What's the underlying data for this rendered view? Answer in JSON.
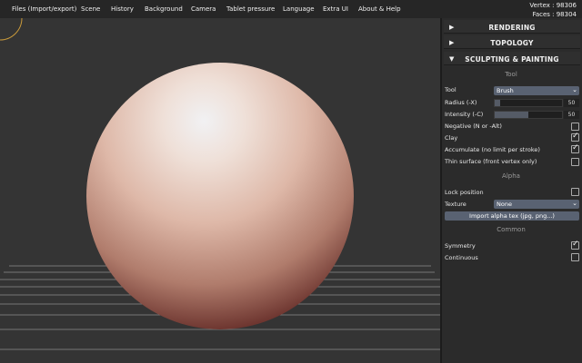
{
  "menu": {
    "items": [
      "Files (Import/export)",
      "Scene",
      "History",
      "Background",
      "Camera",
      "Tablet pressure",
      "Language",
      "Extra UI",
      "About & Help"
    ]
  },
  "stats": {
    "vertex": "Vertex : 98306",
    "faces": "Faces : 98304"
  },
  "panel": {
    "rendering": {
      "arrow": "▶",
      "title": "RENDERING"
    },
    "topology": {
      "arrow": "▶",
      "title": "TOPOLOGY"
    },
    "sculpting": {
      "arrow": "▼",
      "title": "SCULPTING & PAINTING"
    },
    "tool_section": "Tool",
    "tool_label": "Tool",
    "tool_value": "Brush",
    "radius_label": "Radius (-X)",
    "radius_value": "50",
    "intensity_label": "Intensity (-C)",
    "intensity_value": "50",
    "negative_label": "Negative (N or -Alt)",
    "clay_label": "Clay",
    "accumulate_label": "Accumulate (no limit per stroke)",
    "thin_label": "Thin surface (front vertex only)",
    "alpha_section": "Alpha",
    "lock_label": "Lock position",
    "texture_label": "Texture",
    "texture_value": "None",
    "import_label": "Import alpha tex (jpg, png...)",
    "common_section": "Common",
    "symmetry_label": "Symmetry",
    "continuous_label": "Continuous",
    "checked_mark": "✓",
    "chevron": "⌄"
  },
  "controls": {
    "radius_fraction": 0.08,
    "intensity_fraction": 0.5,
    "negative_checked": false,
    "clay_checked": true,
    "accumulate_checked": true,
    "thin_checked": false,
    "lock_checked": false,
    "symmetry_checked": true,
    "continuous_checked": false
  },
  "icons": {
    "menu_collapsed": "triangle-right-icon",
    "menu_expanded": "triangle-down-icon",
    "check": "checkmark-icon",
    "brush_cursor": "circle-cursor-icon"
  },
  "colors": {
    "menubar": "#262626",
    "viewport_bg": "#343434",
    "panel_bg": "#2b2b2b",
    "accent": "#596272",
    "brush_cursor": "#c99a3a",
    "sphere_light": "#f2e2da",
    "sphere_dark": "#5a2a24"
  }
}
